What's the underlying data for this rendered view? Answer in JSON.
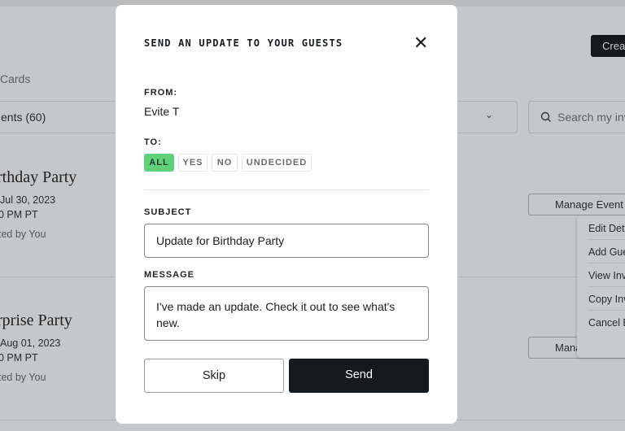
{
  "background": {
    "create_button": "Crea",
    "tab_cards": "Cards",
    "filter_label": "ents (60)",
    "search_placeholder": "Search my inv",
    "events": [
      {
        "title": "rthday Party",
        "date": "Jul 30, 2023",
        "time": "0 PM PT",
        "host": "ted by You",
        "manage": "Manage Event"
      },
      {
        "title": "rprise Party",
        "date": "Aug 01, 2023",
        "time": "0 PM PT",
        "host": "ted by You",
        "manage": "Manage Event"
      }
    ],
    "menu": [
      "Edit Det",
      "Add Gue",
      "View Inv",
      "Copy Inv",
      "Cancel E"
    ]
  },
  "modal": {
    "title": "SEND AN UPDATE TO YOUR GUESTS",
    "from_label": "FROM:",
    "from_value": "Evite T",
    "to_label": "TO:",
    "chips": [
      "ALL",
      "YES",
      "NO",
      "UNDECIDED"
    ],
    "active_chip": "ALL",
    "accent": "#5fd07b",
    "subject_label": "SUBJECT",
    "subject_value": "Update for Birthday Party",
    "message_label": "MESSAGE",
    "message_value": "I've made an update. Check it out to see what's new.",
    "skip": "Skip",
    "send": "Send"
  }
}
